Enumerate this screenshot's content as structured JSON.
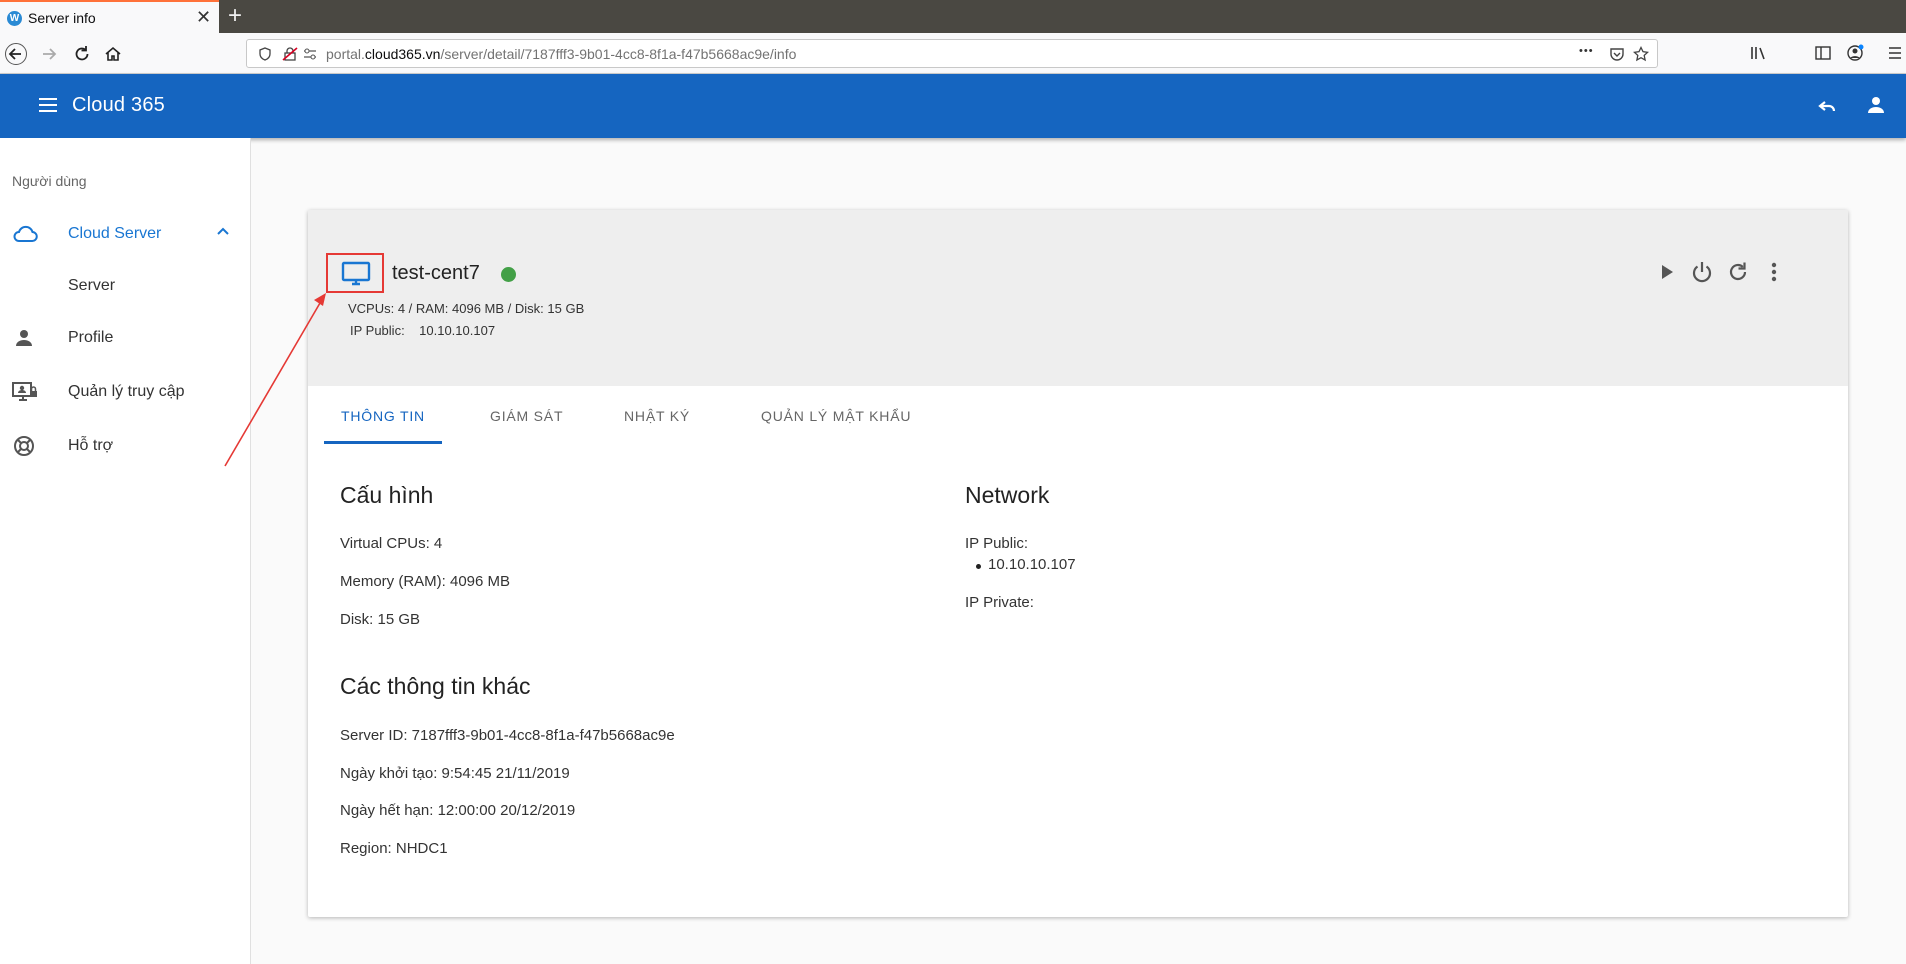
{
  "browser": {
    "tab_title": "Server info",
    "tab_favicon_letter": "W",
    "close_glyph": "✕",
    "newtab_glyph": "+",
    "url_prefix": "portal.",
    "url_host": "cloud365.vn",
    "url_path": "/server/detail/7187fff3-9b01-4cc8-8f1a-f47b5668ac9e/info",
    "more_glyph": "•••"
  },
  "app": {
    "title": "Cloud 365",
    "brand_color": "#1565c0"
  },
  "sidebar": {
    "subheader": "Người dùng",
    "items": [
      {
        "label": "Cloud Server",
        "icon": "cloud-icon",
        "active": true,
        "expanded": true
      },
      {
        "label": "Server",
        "icon": "",
        "child": true
      },
      {
        "label": "Profile",
        "icon": "person-icon"
      },
      {
        "label": "Quản lý truy cập",
        "icon": "access-control-icon"
      },
      {
        "label": "Hỗ trợ",
        "icon": "lifebuoy-icon"
      }
    ]
  },
  "server": {
    "name": "test-cent7",
    "status_color": "#43a047",
    "specs": "VCPUs: 4 / RAM: 4096 MB / Disk: 15 GB",
    "ip_label": "IP Public:",
    "ip_value": "10.10.10.107",
    "actions": [
      "play-icon",
      "power-icon",
      "refresh-icon",
      "more-vert-icon"
    ]
  },
  "tabs": [
    {
      "label": "THÔNG TIN",
      "active": true
    },
    {
      "label": "GIÁM SÁT",
      "active": false
    },
    {
      "label": "NHẬT KÝ",
      "active": false
    },
    {
      "label": "QUẢN LÝ MẬT KHẨU",
      "active": false
    }
  ],
  "config": {
    "title": "Cấu hình",
    "vcpus": "Virtual CPUs: 4",
    "memory": "Memory (RAM): 4096 MB",
    "disk": "Disk: 15 GB"
  },
  "network": {
    "title": "Network",
    "public_label": "IP Public:",
    "public_ips": [
      "10.10.10.107"
    ],
    "private_label": "IP Private:"
  },
  "other": {
    "title": "Các thông tin khác",
    "server_id": "Server ID: 7187fff3-9b01-4cc8-8f1a-f47b5668ac9e",
    "created": "Ngày khởi tạo: 9:54:45 21/11/2019",
    "expires": "Ngày hết hạn: 12:00:00 20/12/2019",
    "region": "Region: NHDC1"
  }
}
